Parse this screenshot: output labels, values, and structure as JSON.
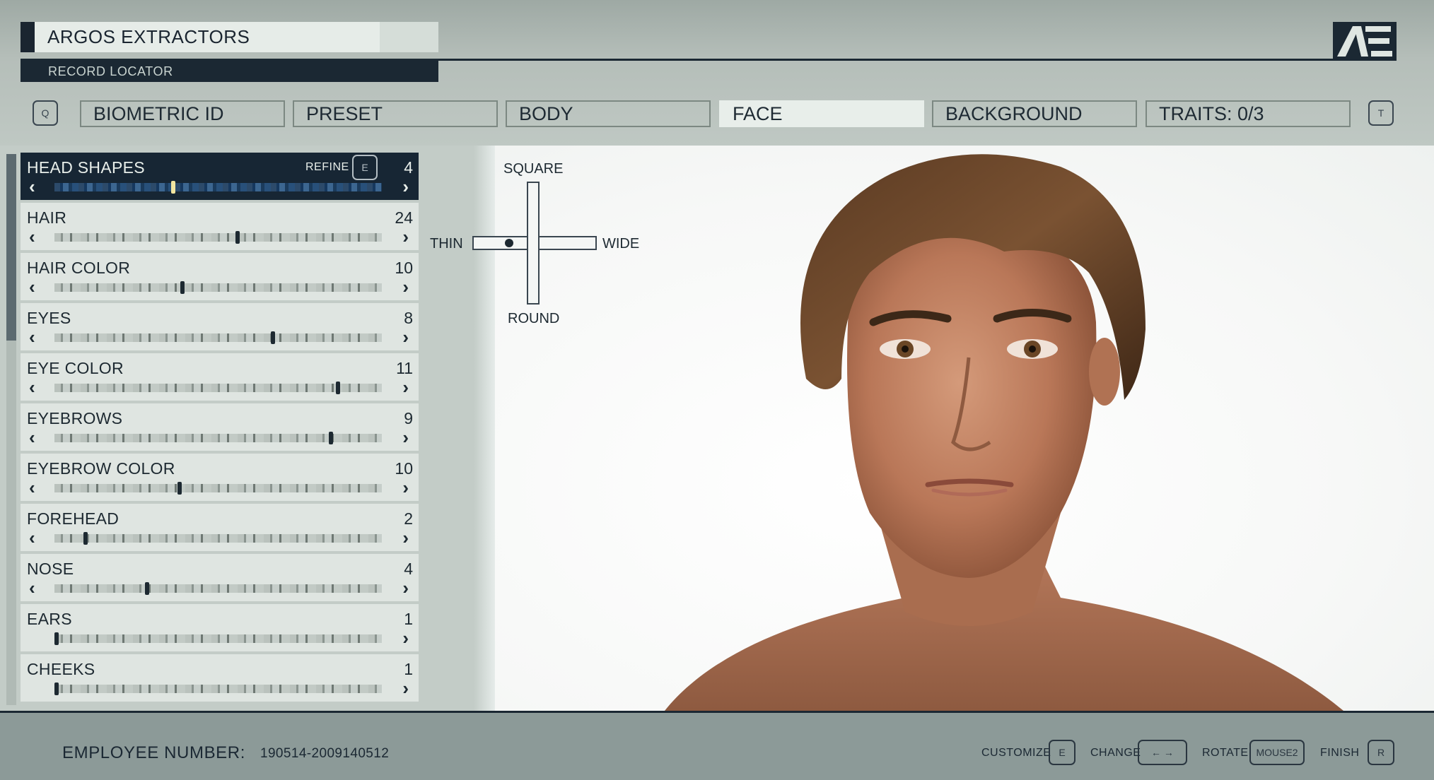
{
  "header": {
    "company": "ARGOS EXTRACTORS",
    "record_locator": "RECORD LOCATOR",
    "logo_text": "AE"
  },
  "tabs": {
    "prev_key": "Q",
    "next_key": "T",
    "items": [
      {
        "label": "BIOMETRIC ID",
        "active": false
      },
      {
        "label": "PRESET",
        "active": false
      },
      {
        "label": "BODY",
        "active": false
      },
      {
        "label": "FACE",
        "active": true
      },
      {
        "label": "BACKGROUND",
        "active": false
      },
      {
        "label": "TRAITS: 0/3",
        "active": false
      }
    ]
  },
  "options": {
    "refine_label": "REFINE",
    "refine_key": "E",
    "items": [
      {
        "label": "HEAD SHAPES",
        "count": "4",
        "selected": true,
        "position": 0.36
      },
      {
        "label": "HAIR",
        "count": "24",
        "selected": false,
        "position": 0.56
      },
      {
        "label": "HAIR COLOR",
        "count": "10",
        "selected": false,
        "position": 0.39
      },
      {
        "label": "EYES",
        "count": "8",
        "selected": false,
        "position": 0.67
      },
      {
        "label": "EYE COLOR",
        "count": "11",
        "selected": false,
        "position": 0.87
      },
      {
        "label": "EYEBROWS",
        "count": "9",
        "selected": false,
        "position": 0.85
      },
      {
        "label": "EYEBROW COLOR",
        "count": "10",
        "selected": false,
        "position": 0.38
      },
      {
        "label": "FOREHEAD",
        "count": "2",
        "selected": false,
        "position": 0.09
      },
      {
        "label": "NOSE",
        "count": "4",
        "selected": false,
        "position": 0.28
      },
      {
        "label": "EARS",
        "count": "1",
        "selected": false,
        "position": 0.0
      },
      {
        "label": "CHEEKS",
        "count": "1",
        "selected": false,
        "position": 0.0
      }
    ]
  },
  "shape_compass": {
    "top": "SQUARE",
    "bottom": "ROUND",
    "left": "THIN",
    "right": "WIDE"
  },
  "footer": {
    "employee_label": "EMPLOYEE NUMBER:",
    "employee_number": "190514-2009140512",
    "hints": [
      {
        "label": "CUSTOMIZE",
        "key": "E"
      },
      {
        "label": "CHANGE",
        "key": "← →"
      },
      {
        "label": "ROTATE",
        "key": "MOUSE2"
      },
      {
        "label": "FINISH",
        "key": "R"
      }
    ]
  }
}
